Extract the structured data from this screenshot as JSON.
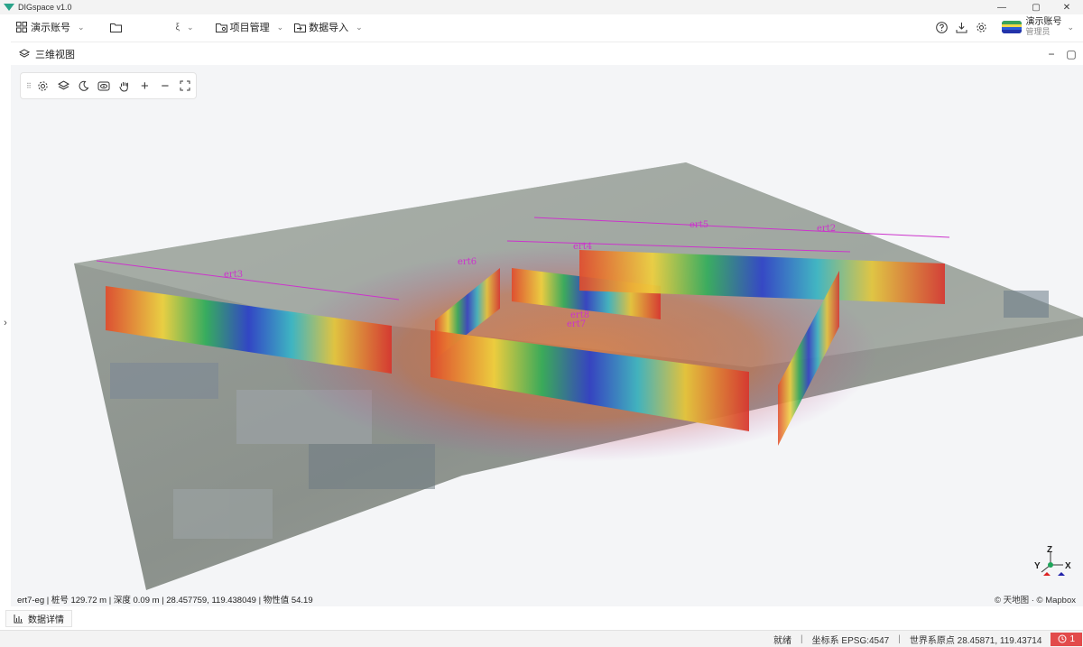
{
  "app": {
    "title": "DIGspace v1.0"
  },
  "menubar": {
    "account_label": "演示账号",
    "project_folder_label": "",
    "project_manage_label": "项目管理",
    "data_import_label": "数据导入"
  },
  "user": {
    "name": "演示账号",
    "role": "管理员"
  },
  "panel": {
    "title": "三维视图"
  },
  "viewport": {
    "profile_labels": [
      "ert3",
      "ert6",
      "ert4",
      "ert5",
      "ert2",
      "ert8",
      "ert7"
    ],
    "coord_readout": "ert7-eg | 桩号 129.72 m | 深度 0.09 m | 28.457759, 119.438049 | 物性值 54.19",
    "attribution": "© 天地图 · © Mapbox",
    "axis_labels": {
      "z": "Z",
      "y": "Y",
      "x": "X"
    }
  },
  "detail_tab": {
    "label": "数据详情"
  },
  "statusbar": {
    "state": "就绪",
    "crs": "坐标系 EPSG:4547",
    "origin": "世界系原点  28.45871, 119.43714",
    "alert_count": "1"
  },
  "colors": {
    "accent": "#1a73e8",
    "alert": "#e24b4b"
  }
}
